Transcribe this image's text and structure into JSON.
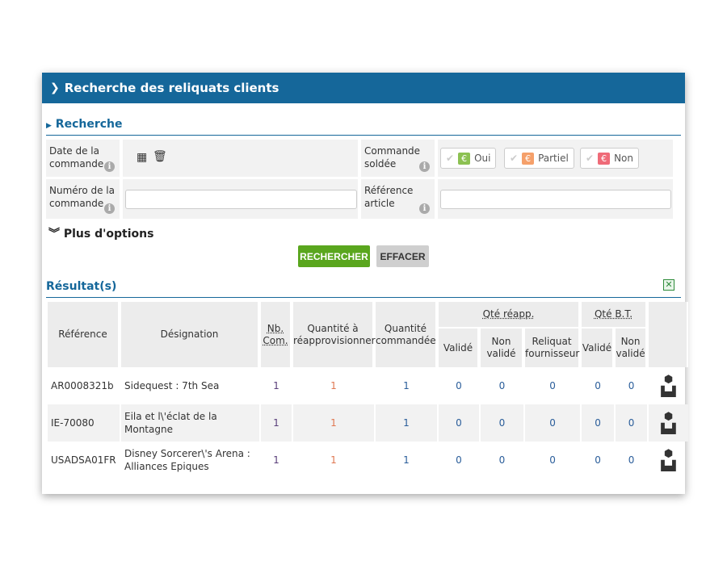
{
  "title": "Recherche des reliquats clients",
  "search": {
    "heading": "Recherche",
    "date_label": "Date de la commande",
    "soldee_label": "Commande soldée",
    "soldee_options": [
      {
        "label": "Oui",
        "color": "#8cc152"
      },
      {
        "label": "Partiel",
        "color": "#f5a06a"
      },
      {
        "label": "Non",
        "color": "#ef6b78"
      }
    ],
    "numero_label": "Numéro de la commande",
    "numero_value": "",
    "reference_label": "Référence article",
    "reference_value": "",
    "more_options": "Plus d'options",
    "search_button": "RECHERCHER",
    "clear_button": "EFFACER"
  },
  "results": {
    "heading": "Résultat(s)",
    "headers": {
      "reference": "Référence",
      "designation": "Désignation",
      "nbcom": "Nb. Com.",
      "qte_reappro": "Quantité à réapprovisionner",
      "qte_cmd": "Quantité commandée",
      "qte_reapp": "Qté réapp.",
      "qte_bt": "Qté B.T.",
      "valide": "Validé",
      "non_valide": "Non validé",
      "reliquat": "Reliquat fournisseur"
    },
    "rows": [
      {
        "ref": "AR0008321b",
        "designation": "Sidequest : 7th Sea",
        "nbcom": "1",
        "reappro": "1",
        "cmd": "1",
        "r_valide": "0",
        "r_non": "0",
        "r_reliquat": "0",
        "bt_valide": "0",
        "bt_non": "0"
      },
      {
        "ref": "IE-70080",
        "designation": "Eila et l\\'éclat de la Montagne",
        "nbcom": "1",
        "reappro": "1",
        "cmd": "1",
        "r_valide": "0",
        "r_non": "0",
        "r_reliquat": "0",
        "bt_valide": "0",
        "bt_non": "0"
      },
      {
        "ref": "USADSA01FR",
        "designation": "Disney Sorcerer\\'s Arena : Alliances Epiques",
        "nbcom": "1",
        "reappro": "1",
        "cmd": "1",
        "r_valide": "0",
        "r_non": "0",
        "r_reliquat": "0",
        "bt_valide": "0",
        "bt_non": "0"
      }
    ]
  }
}
